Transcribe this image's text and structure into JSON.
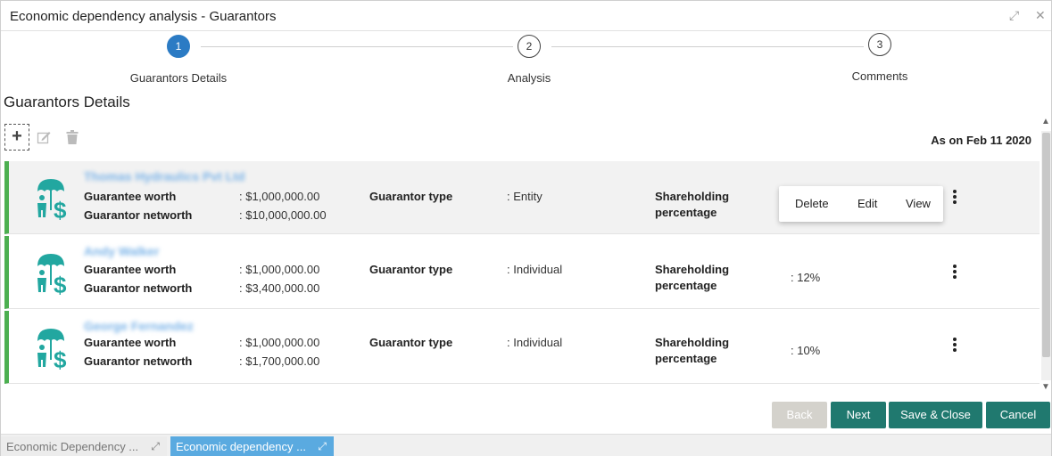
{
  "window": {
    "title": "Economic dependency analysis - Guarantors",
    "expand_glyph": "⤢",
    "close_glyph": "✕"
  },
  "stepper": {
    "steps": [
      {
        "number": "1",
        "label": "Guarantors Details",
        "active": true
      },
      {
        "number": "2",
        "label": "Analysis",
        "active": false
      },
      {
        "number": "3",
        "label": "Comments",
        "active": false
      }
    ]
  },
  "section": {
    "title": "Guarantors Details"
  },
  "toolbar": {
    "add_glyph": "+",
    "edit_icon": "edit-icon",
    "delete_icon": "trash-icon"
  },
  "as_on": "As on Feb 11 2020",
  "labels": {
    "guarantee_worth": "Guarantee worth",
    "guarantor_networth": "Guarantor networth",
    "guarantor_type": "Guarantor type",
    "shareholding_line1": "Shareholding",
    "shareholding_line2": "percentage"
  },
  "guarantors": [
    {
      "name": "Thomas Hydraulics Pvt Ltd",
      "guarantee_worth": ": $1,000,000.00",
      "guarantor_networth": ": $10,000,000.00",
      "guarantor_type": ":  Entity",
      "shareholding": ""
    },
    {
      "name": "Andy Walker",
      "guarantee_worth": ": $1,000,000.00",
      "guarantor_networth": ": $3,400,000.00",
      "guarantor_type": ": Individual",
      "shareholding": ":   12%"
    },
    {
      "name": "George Fernandez",
      "guarantee_worth": ": $1,000,000.00",
      "guarantor_networth": ": $1,700,000.00",
      "guarantor_type": ": Individual",
      "shareholding": ":   10%"
    }
  ],
  "context_menu": {
    "delete": "Delete",
    "edit": "Edit",
    "view": "View"
  },
  "buttons": {
    "back": "Back",
    "next": "Next",
    "save_close": "Save & Close",
    "cancel": "Cancel"
  },
  "taskbar": {
    "tabs": [
      {
        "label": "Economic Dependency ...",
        "active": false
      },
      {
        "label": "Economic dependency ...",
        "active": true
      }
    ],
    "expand_glyph": "⤢"
  },
  "colors": {
    "accent": "#2b7bc4",
    "primary_button": "#20796f",
    "card_border": "#4caf50",
    "active_tab": "#5aaae0"
  }
}
